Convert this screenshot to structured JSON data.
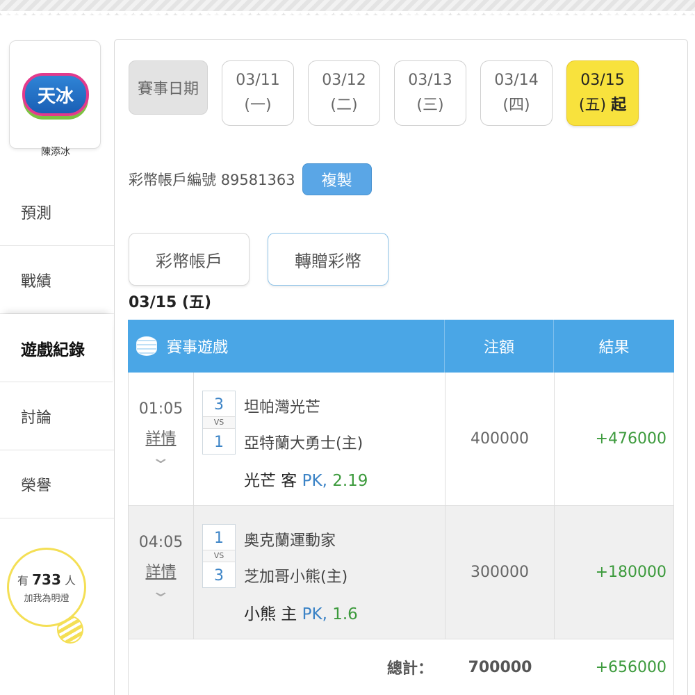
{
  "sidebar": {
    "logo_text": "天冰",
    "username": "陳添冰",
    "nav": [
      {
        "label": "預測"
      },
      {
        "label": "戰績"
      },
      {
        "label": "遊戲紀錄"
      },
      {
        "label": "討論"
      },
      {
        "label": "榮譽"
      }
    ],
    "active_nav": "遊戲紀錄",
    "lamp": {
      "prefix": "有",
      "count": "733",
      "suffix": "人",
      "caption": "加我為明燈"
    }
  },
  "dates": {
    "label": "賽事日期",
    "items": [
      {
        "date": "03/11",
        "day": "(一)",
        "qi": ""
      },
      {
        "date": "03/12",
        "day": "(二)",
        "qi": ""
      },
      {
        "date": "03/13",
        "day": "(三)",
        "qi": ""
      },
      {
        "date": "03/14",
        "day": "(四)",
        "qi": ""
      },
      {
        "date": "03/15",
        "day": "(五)",
        "qi": "起"
      }
    ],
    "active_date": "03/15"
  },
  "account": {
    "label": "彩幣帳戶編號",
    "number": "89581363",
    "copy_label": "複製"
  },
  "tabs": {
    "account": "彩幣帳戶",
    "transfer": "轉贈彩幣"
  },
  "day_title": "03/15 (五)",
  "table": {
    "headers": {
      "game": "賽事遊戲",
      "amount": "注額",
      "result": "結果"
    },
    "rows": [
      {
        "time": "01:05",
        "detail": "詳情",
        "score_away": "3",
        "vs": "VS",
        "score_home": "1",
        "team_away": "坦帕灣光芒",
        "team_home": "亞特蘭大勇士(主)",
        "pick_team": "光芒 客",
        "pick_type": "PK,",
        "pick_odds": "2.19",
        "amount": "400000",
        "result": "+476000"
      },
      {
        "time": "04:05",
        "detail": "詳情",
        "score_away": "1",
        "vs": "VS",
        "score_home": "3",
        "team_away": "奧克蘭運動家",
        "team_home": "芝加哥小熊(主)",
        "pick_team": "小熊 主",
        "pick_type": "PK,",
        "pick_odds": "1.6",
        "amount": "300000",
        "result": "+180000"
      }
    ],
    "total": {
      "label": "總計：",
      "amount": "700000",
      "result": "+656000"
    }
  },
  "colors": {
    "accent_blue": "#4aa6e6",
    "active_yellow": "#f8e23d",
    "win_green": "#3c9a3c",
    "lamp_yellow": "#f4df55"
  }
}
